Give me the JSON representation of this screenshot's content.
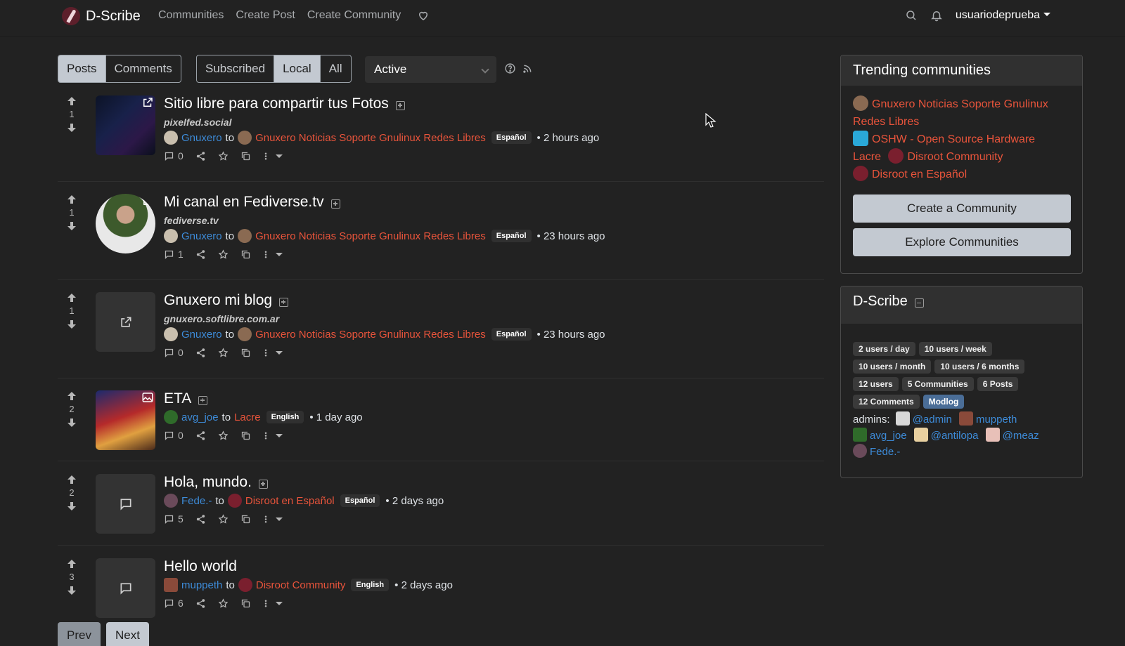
{
  "brand": {
    "name": "D-Scribe"
  },
  "nav": {
    "communities": "Communities",
    "create_post": "Create Post",
    "create_community": "Create Community",
    "user": "usuariodeprueba"
  },
  "filters": {
    "type": [
      "Posts",
      "Comments"
    ],
    "listing": [
      "Subscribed",
      "Local",
      "All"
    ],
    "sort": "Active"
  },
  "posts": [
    {
      "score": "1",
      "title": "Sitio libre para compartir tus Fotos",
      "domain": "pixelfed.social",
      "user": "Gnuxero",
      "to": "to",
      "community": "Gnuxero Noticias Soporte Gnulinux Redes Libres",
      "lang": "Español",
      "time": "• 2 hours ago",
      "comments": "0"
    },
    {
      "score": "1",
      "title": "Mi canal en Fediverse.tv",
      "domain": "fediverse.tv",
      "user": "Gnuxero",
      "to": "to",
      "community": "Gnuxero Noticias Soporte Gnulinux Redes Libres",
      "lang": "Español",
      "time": "• 23 hours ago",
      "comments": "1"
    },
    {
      "score": "1",
      "title": "Gnuxero mi blog",
      "domain": "gnuxero.softlibre.com.ar",
      "user": "Gnuxero",
      "to": "to",
      "community": "Gnuxero Noticias Soporte Gnulinux Redes Libres",
      "lang": "Español",
      "time": "• 23 hours ago",
      "comments": "0"
    },
    {
      "score": "2",
      "title": "ETA",
      "user": "avg_joe",
      "to": "to",
      "community": "Lacre",
      "lang": "English",
      "time": "• 1 day ago",
      "comments": "0"
    },
    {
      "score": "2",
      "title": "Hola, mundo.",
      "user": "Fede.-",
      "to": "to",
      "community": "Disroot en Español",
      "lang": "Español",
      "time": "• 2 days ago",
      "comments": "5"
    },
    {
      "score": "3",
      "title": "Hello world",
      "user": "muppeth",
      "to": "to",
      "community": "Disroot Community",
      "lang": "English",
      "time": "• 2 days ago",
      "comments": "6"
    }
  ],
  "pagination": {
    "prev": "Prev",
    "next": "Next"
  },
  "trending": {
    "title": "Trending communities",
    "items": [
      "Gnuxero Noticias Soporte Gnulinux Redes Libres",
      "OSHW - Open Source Hardware",
      "Lacre",
      "Disroot Community",
      "Disroot en Español"
    ],
    "create_btn": "Create a Community",
    "explore_btn": "Explore Communities"
  },
  "site": {
    "title": "D-Scribe",
    "stats": [
      "2 users / day",
      "10 users / week",
      "10 users / month",
      "10 users / 6 months",
      "12 users",
      "5 Communities",
      "6 Posts",
      "12 Comments"
    ],
    "modlog": "Modlog",
    "admins_label": "admins:",
    "admins": [
      "@admin",
      "muppeth",
      "avg_joe",
      "@antilopa",
      "@meaz",
      "Fede.-"
    ]
  },
  "colors": {
    "background": "#222222",
    "user_link": "#3d8bd8",
    "community_link": "#e8543b",
    "active_button": "#c3c9d1"
  }
}
